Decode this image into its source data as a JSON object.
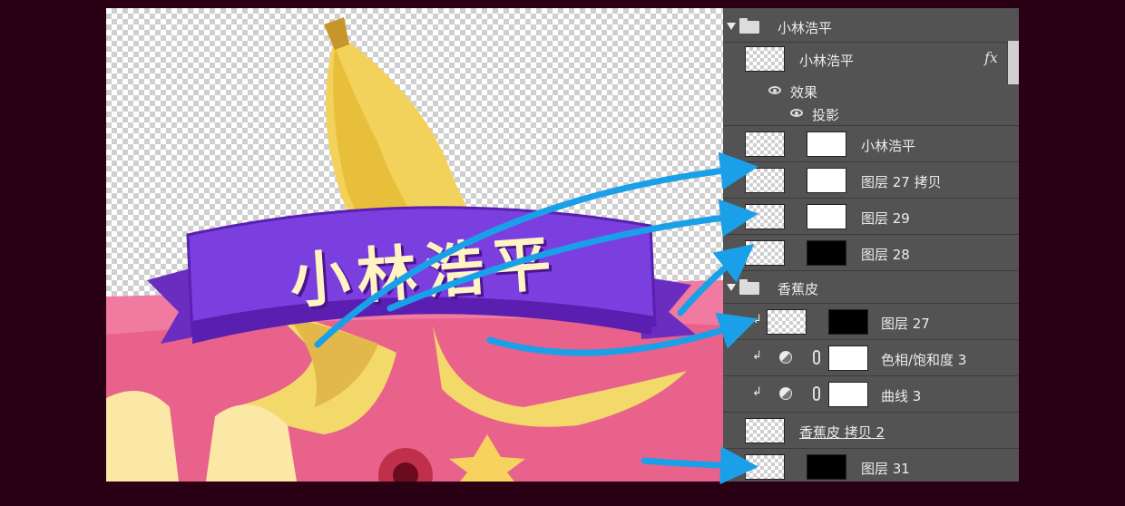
{
  "canvas": {
    "banner_text": "小林浩平"
  },
  "layers": {
    "group1": {
      "name": "小林浩平"
    },
    "smart": {
      "name": "小林浩平",
      "fx": "fx"
    },
    "effects": {
      "label": "效果"
    },
    "shadow": {
      "label": "投影"
    },
    "row_a": {
      "name": "小林浩平"
    },
    "row_b": {
      "name": "图层 27 拷贝"
    },
    "row_c": {
      "name": "图层 29"
    },
    "row_d": {
      "name": "图层 28"
    },
    "group2": {
      "name": "香蕉皮"
    },
    "row_e": {
      "name": "图层 27"
    },
    "row_f": {
      "name": "色相/饱和度 3"
    },
    "row_g": {
      "name": "曲线 3"
    },
    "row_h": {
      "name": "香蕉皮 拷贝 2"
    },
    "row_i": {
      "name": "图层 31"
    }
  },
  "colors": {
    "background": "#2a0014",
    "panel": "#535353",
    "arrow": "#1aa0e8",
    "banner": "#7b3fe0"
  }
}
